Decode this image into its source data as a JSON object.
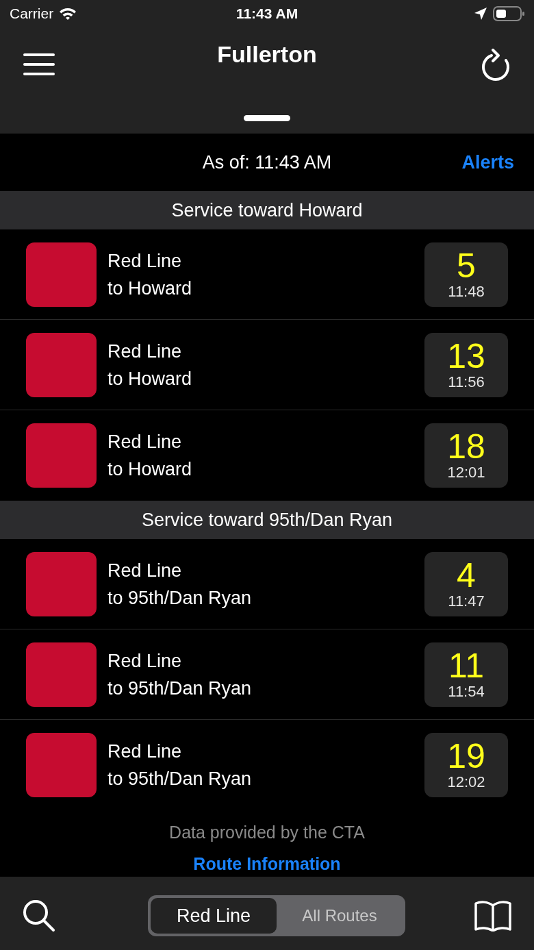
{
  "status_bar": {
    "carrier": "Carrier",
    "time": "11:43 AM"
  },
  "nav": {
    "title": "Fullerton"
  },
  "updated": {
    "text": "As of: 11:43 AM",
    "alerts": "Alerts"
  },
  "sections": [
    {
      "title": "Service toward Howard",
      "arrivals": [
        {
          "line": "Red Line",
          "destination": "to Howard",
          "minutes": "5",
          "time": "11:48"
        },
        {
          "line": "Red Line",
          "destination": "to Howard",
          "minutes": "13",
          "time": "11:56"
        },
        {
          "line": "Red Line",
          "destination": "to Howard",
          "minutes": "18",
          "time": "12:01"
        }
      ]
    },
    {
      "title": "Service toward 95th/Dan Ryan",
      "arrivals": [
        {
          "line": "Red Line",
          "destination": "to 95th/Dan Ryan",
          "minutes": "4",
          "time": "11:47"
        },
        {
          "line": "Red Line",
          "destination": "to 95th/Dan Ryan",
          "minutes": "11",
          "time": "11:54"
        },
        {
          "line": "Red Line",
          "destination": "to 95th/Dan Ryan",
          "minutes": "19",
          "time": "12:02"
        }
      ]
    }
  ],
  "footer": {
    "credit": "Data provided by the CTA",
    "link": "Route Information"
  },
  "segments": [
    {
      "label": "Red Line",
      "selected": true
    },
    {
      "label": "All Routes",
      "selected": false
    }
  ]
}
